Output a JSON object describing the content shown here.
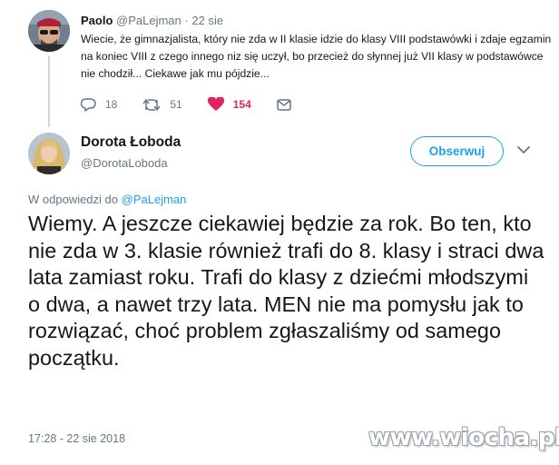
{
  "reply_tweet": {
    "author_name": "Paolo",
    "author_handle": "@PaLejman",
    "separator": "·",
    "time_ago": "22 sie",
    "text": "Wiecie, że gimnazjalista, który nie zda w II klasie idzie do klasy VIII podstawówki i zdaje egzamin na koniec VIII z czego innego niz się uczył, bo przecież do słynnej już VII klasy w podstawówce nie chodził... Ciekawe jak mu pójdzie...",
    "actions": {
      "reply_count": "18",
      "retweet_count": "51",
      "like_count": "154"
    }
  },
  "main_tweet": {
    "author_name": "Dorota Łoboda",
    "author_handle": "@DorotaLoboda",
    "follow_label": "Obserwuj",
    "in_reply_prefix": "W odpowiedzi do",
    "in_reply_handle": "@PaLejman",
    "text": "Wiemy. A jeszcze ciekawiej będzie za rok. Bo ten, kto nie zda w 3. klasie również trafi do 8. klasy i straci dwa lata zamiast roku. Trafi do klasy z dziećmi młodszymi o dwa, a nawet trzy lata. MEN nie ma pomysłu jak to rozwiązać, choć problem zgłaszaliśmy od samego początku.",
    "timestamp": "17:28 - 22 sie 2018"
  },
  "watermark": "www.wiocha.pl",
  "colors": {
    "accent": "#1da1f2",
    "like": "#e0245e",
    "muted": "#657786"
  }
}
